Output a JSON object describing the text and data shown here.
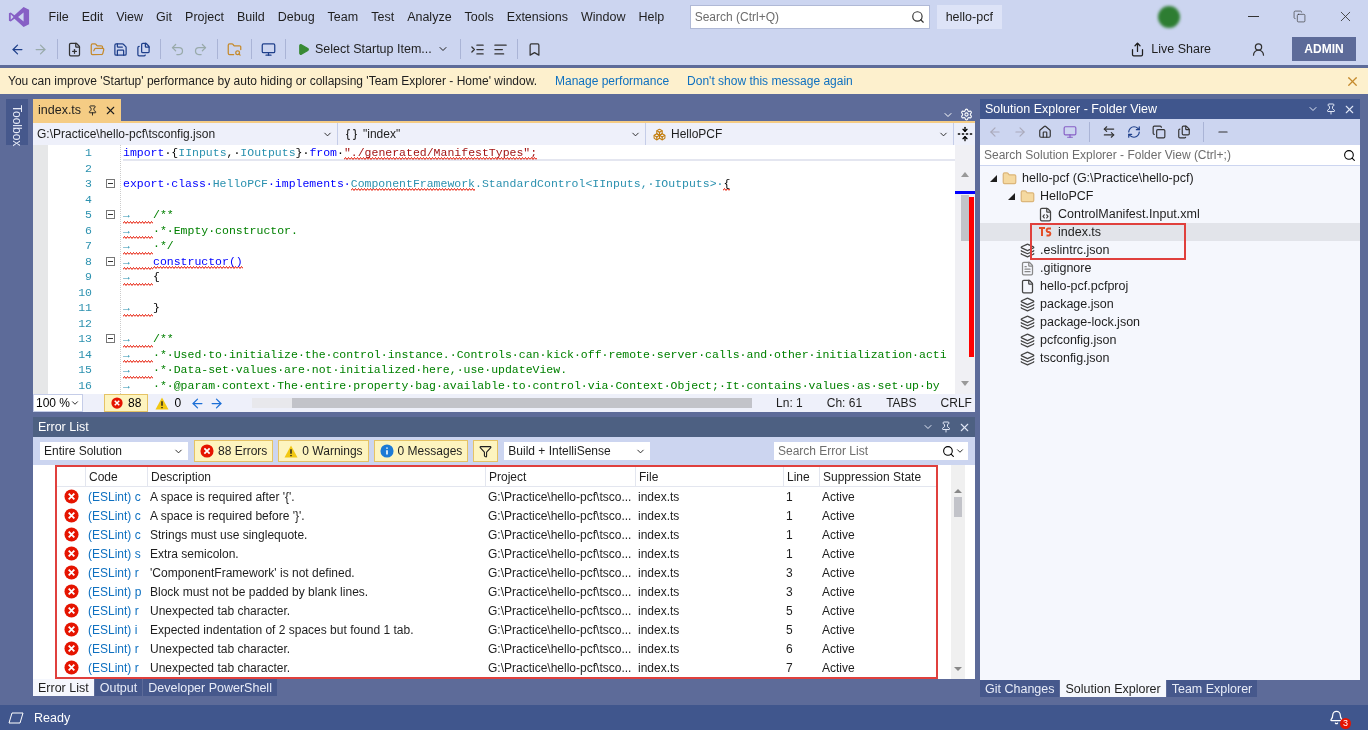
{
  "menu_bar": {
    "items": [
      "File",
      "Edit",
      "View",
      "Git",
      "Project",
      "Build",
      "Debug",
      "Team",
      "Test",
      "Analyze",
      "Tools",
      "Extensions",
      "Window",
      "Help"
    ],
    "search": {
      "placeholder": "Search (Ctrl+Q)"
    },
    "solution_name": "hello-pcf"
  },
  "toolbar": {
    "startup_item": "Select Startup Item...",
    "live_share": "Live Share",
    "account": "ADMIN"
  },
  "info_bar": {
    "message": "You can improve 'Startup' performance by auto hiding or collapsing 'Team Explorer - Home' window.",
    "links": [
      "Manage performance",
      "Don't show this message again"
    ]
  },
  "toolbox": {
    "label": "Toolbox"
  },
  "editor": {
    "tabs": [
      {
        "label": "index.ts",
        "selected": true
      }
    ],
    "nav": {
      "project": "G:\\Practice\\hello-pcf\\tsconfig.json",
      "scope": "\"index\"",
      "member": "HelloPCF"
    },
    "lines": [
      {
        "number": "1",
        "fold": false,
        "current": true,
        "segments": [
          {
            "kind": "keyword",
            "text": "import",
            "squiggle": false
          },
          {
            "kind": "plain",
            "text": "·{",
            "squiggle": false
          },
          {
            "kind": "type",
            "text": "IInputs",
            "squiggle": false
          },
          {
            "kind": "plain",
            "text": ",·",
            "squiggle": false
          },
          {
            "kind": "type",
            "text": "IOutputs",
            "squiggle": false
          },
          {
            "kind": "plain",
            "text": "}·",
            "squiggle": false
          },
          {
            "kind": "keyword",
            "text": "from",
            "squiggle": false
          },
          {
            "kind": "plain",
            "text": "·",
            "squiggle": false
          },
          {
            "kind": "string",
            "text": "\"./generated/ManifestTypes\";",
            "squiggle": true
          }
        ]
      },
      {
        "number": "2",
        "fold": false,
        "current": false
      },
      {
        "number": "3",
        "fold": true,
        "current": false,
        "segments": [
          {
            "kind": "keyword",
            "text": "export·class·",
            "squiggle": false
          },
          {
            "kind": "type",
            "text": "HelloPCF",
            "squiggle": false
          },
          {
            "kind": "keyword",
            "text": "·implements·",
            "squiggle": false
          },
          {
            "kind": "type",
            "text": "ComponentFramework",
            "squiggle": true
          },
          {
            "kind": "type",
            "text": ".StandardControl<IInputs,·IOutputs>·",
            "squiggle": false
          },
          {
            "kind": "plain",
            "text": "{",
            "squiggle": true
          }
        ]
      },
      {
        "number": "4",
        "fold": false,
        "current": false
      },
      {
        "number": "5",
        "fold": true,
        "current": false,
        "segments": [
          {
            "kind": "tab",
            "text": "→",
            "squiggle": true
          },
          {
            "kind": "comment",
            "text": "/**",
            "squiggle": false
          }
        ]
      },
      {
        "number": "6",
        "fold": false,
        "current": false,
        "segments": [
          {
            "kind": "tab",
            "text": "→",
            "squiggle": true
          },
          {
            "kind": "comment",
            "text": "·*·Empty·constructor.",
            "squiggle": false
          }
        ]
      },
      {
        "number": "7",
        "fold": false,
        "current": false,
        "segments": [
          {
            "kind": "tab",
            "text": "→",
            "squiggle": true
          },
          {
            "kind": "comment",
            "text": "·*/",
            "squiggle": false
          }
        ]
      },
      {
        "number": "8",
        "fold": true,
        "current": false,
        "segments": [
          {
            "kind": "tab",
            "text": "→",
            "squiggle": true
          },
          {
            "kind": "keyword",
            "text": "constructor()",
            "squiggle": true
          }
        ]
      },
      {
        "number": "9",
        "fold": false,
        "current": false,
        "segments": [
          {
            "kind": "tab",
            "text": "→",
            "squiggle": true
          },
          {
            "kind": "plain",
            "text": "{",
            "squiggle": false
          }
        ]
      },
      {
        "number": "10",
        "fold": false,
        "current": false
      },
      {
        "number": "11",
        "fold": false,
        "current": false,
        "segments": [
          {
            "kind": "tab",
            "text": "→",
            "squiggle": true
          },
          {
            "kind": "plain",
            "text": "}",
            "squiggle": false
          }
        ]
      },
      {
        "number": "12",
        "fold": false,
        "current": false
      },
      {
        "number": "13",
        "fold": true,
        "current": false,
        "segments": [
          {
            "kind": "tab",
            "text": "→",
            "squiggle": true
          },
          {
            "kind": "comment",
            "text": "/**",
            "squiggle": false
          }
        ]
      },
      {
        "number": "14",
        "fold": false,
        "current": false,
        "segments": [
          {
            "kind": "tab",
            "text": "→",
            "squiggle": true
          },
          {
            "kind": "comment",
            "text": "·*·Used·to·initialize·the·control·instance.·Controls·can·kick·off·remote·server·calls·and·other·initialization·acti",
            "squiggle": false
          }
        ]
      },
      {
        "number": "15",
        "fold": false,
        "current": false,
        "segments": [
          {
            "kind": "tab",
            "text": "→",
            "squiggle": true
          },
          {
            "kind": "comment",
            "text": "·*·Data-set·values·are·not·initialized·here,·use·updateView.",
            "squiggle": false
          }
        ]
      },
      {
        "number": "16",
        "fold": false,
        "current": false,
        "segments": [
          {
            "kind": "tab",
            "text": "→",
            "squiggle": false
          },
          {
            "kind": "comment",
            "text": "·*·@param·context·The·entire·property·bag·available·to·control·via·Context·Object;·It·contains·values·as·set·up·by",
            "squiggle": false
          }
        ]
      }
    ],
    "footer": {
      "zoom": "100 %",
      "errors": "88",
      "warnings": "0",
      "line": "Ln: 1",
      "column": "Ch: 61",
      "indent": "TABS",
      "line_ending": "CRLF"
    }
  },
  "error_list": {
    "title": "Error List",
    "scope": "Entire Solution",
    "filters": [
      {
        "kind": "error",
        "label": "88 Errors",
        "selected": true
      },
      {
        "kind": "warning",
        "label": "0 Warnings",
        "selected": true
      },
      {
        "kind": "message",
        "label": "0 Messages",
        "selected": true
      }
    ],
    "source": "Build + IntelliSense",
    "search": {
      "placeholder": "Search Error List"
    },
    "highlighted": true,
    "columns": [
      "Code",
      "Description",
      "Project",
      "File",
      "Line",
      "Suppression State"
    ],
    "rows": [
      {
        "code": "(ESLint) c",
        "description": "A space is required after '{'.",
        "project": "G:\\Practice\\hello-pcf\\tsco...",
        "file": "index.ts",
        "line": "1",
        "state": "Active"
      },
      {
        "code": "(ESLint) c",
        "description": "A space is required before '}'.",
        "project": "G:\\Practice\\hello-pcf\\tsco...",
        "file": "index.ts",
        "line": "1",
        "state": "Active"
      },
      {
        "code": "(ESLint) c",
        "description": "Strings must use singlequote.",
        "project": "G:\\Practice\\hello-pcf\\tsco...",
        "file": "index.ts",
        "line": "1",
        "state": "Active"
      },
      {
        "code": "(ESLint) s",
        "description": "Extra semicolon.",
        "project": "G:\\Practice\\hello-pcf\\tsco...",
        "file": "index.ts",
        "line": "1",
        "state": "Active"
      },
      {
        "code": "(ESLint) r",
        "description": "'ComponentFramework' is not defined.",
        "project": "G:\\Practice\\hello-pcf\\tsco...",
        "file": "index.ts",
        "line": "3",
        "state": "Active"
      },
      {
        "code": "(ESLint) p",
        "description": "Block must not be padded by blank lines.",
        "project": "G:\\Practice\\hello-pcf\\tsco...",
        "file": "index.ts",
        "line": "3",
        "state": "Active"
      },
      {
        "code": "(ESLint) r",
        "description": "Unexpected tab character.",
        "project": "G:\\Practice\\hello-pcf\\tsco...",
        "file": "index.ts",
        "line": "5",
        "state": "Active"
      },
      {
        "code": "(ESLint) i",
        "description": "Expected indentation of 2 spaces but found 1 tab.",
        "project": "G:\\Practice\\hello-pcf\\tsco...",
        "file": "index.ts",
        "line": "5",
        "state": "Active"
      },
      {
        "code": "(ESLint) r",
        "description": "Unexpected tab character.",
        "project": "G:\\Practice\\hello-pcf\\tsco...",
        "file": "index.ts",
        "line": "6",
        "state": "Active"
      },
      {
        "code": "(ESLint) r",
        "description": "Unexpected tab character.",
        "project": "G:\\Practice\\hello-pcf\\tsco...",
        "file": "index.ts",
        "line": "7",
        "state": "Active"
      }
    ],
    "tabs": [
      {
        "label": "Error List",
        "selected": true
      },
      {
        "label": "Output",
        "selected": false
      },
      {
        "label": "Developer PowerShell",
        "selected": false
      }
    ]
  },
  "solution_explorer": {
    "title": "Solution Explorer - Folder View",
    "search": {
      "placeholder": "Search Solution Explorer - Folder View (Ctrl+;)"
    },
    "highlight_frame": true,
    "tree": [
      {
        "label": "hello-pcf (G:\\Practice\\hello-pcf)",
        "kind": "folder",
        "expanded": true,
        "selected": false,
        "children": [
          {
            "label": "HelloPCF",
            "kind": "folder",
            "expanded": true,
            "selected": false,
            "children": [
              {
                "label": "ControlManifest.Input.xml",
                "kind": "xml",
                "selected": false
              },
              {
                "label": "index.ts",
                "kind": "ts",
                "selected": true
              }
            ]
          },
          {
            "label": ".eslintrc.json",
            "kind": "json",
            "selected": false
          },
          {
            "label": ".gitignore",
            "kind": "text",
            "selected": false
          },
          {
            "label": "hello-pcf.pcfproj",
            "kind": "file",
            "selected": false
          },
          {
            "label": "package.json",
            "kind": "json",
            "selected": false
          },
          {
            "label": "package-lock.json",
            "kind": "json",
            "selected": false
          },
          {
            "label": "pcfconfig.json",
            "kind": "json",
            "selected": false
          },
          {
            "label": "tsconfig.json",
            "kind": "json",
            "selected": false
          }
        ]
      }
    ],
    "tabs": [
      {
        "label": "Git Changes",
        "selected": false
      },
      {
        "label": "Solution Explorer",
        "selected": true
      },
      {
        "label": "Team Explorer",
        "selected": false
      }
    ]
  },
  "status_bar": {
    "text": "Ready",
    "notifications": "3"
  }
}
